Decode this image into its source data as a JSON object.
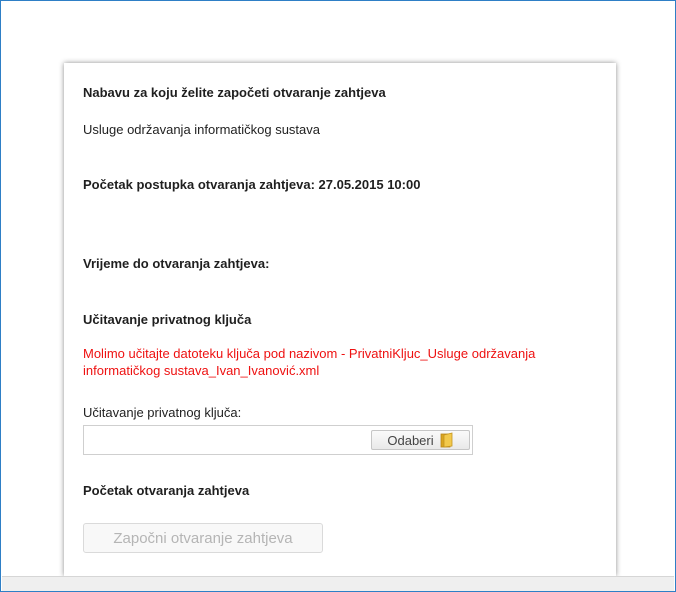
{
  "panel": {
    "procurement_heading": "Nabavu za koju želite započeti otvaranje zahtjeva",
    "procurement_name": "Usluge održavanja informatičkog sustava",
    "start_of_procedure": "Početak postupka otvaranja zahtjeva: 27.05.2015 10:00",
    "time_until_opening": "Vrijeme do otvaranja zahtjeva:",
    "private_key_heading": "Učitavanje privatnog ključa",
    "private_key_message": "Molimo učitajte datoteku ključa pod nazivom - PrivatniKljuc_Usluge održavanja informatičkog sustava_Ivan_Ivanović.xml",
    "private_key_field_label": "Učitavanje privatnog ključa:",
    "file_input_value": "",
    "browse_button_label": "Odaberi",
    "opening_heading": "Početak otvaranja zahtjeva",
    "start_opening_button_label": "Započni otvaranje zahtjeva"
  },
  "colors": {
    "frame_border": "#2e7fc6",
    "error_text": "#ee1111",
    "disabled_text": "#b5b5b5",
    "folder_icon": "#e8b830"
  },
  "icons": {
    "browse": "folder-icon"
  }
}
